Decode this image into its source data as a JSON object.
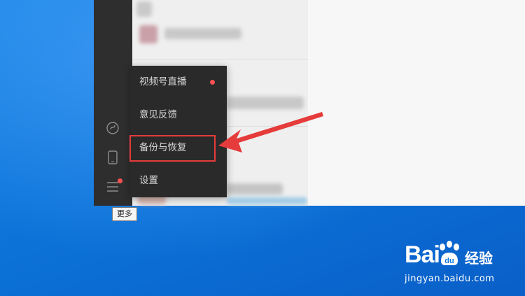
{
  "colors": {
    "desktop_blue": "#0f78dc",
    "sidebar_bg": "#2e2e2e",
    "menu_bg": "#2a2a2a",
    "notification_red": "#fa5151",
    "annotation_red": "#e63b3b"
  },
  "sidebar": {
    "icons": [
      "mini-program-icon",
      "phone-icon",
      "more-menu-icon"
    ]
  },
  "more_menu": {
    "items": [
      {
        "label": "视频号直播",
        "has_dot": true
      },
      {
        "label": "意见反馈",
        "has_dot": false
      },
      {
        "label": "备份与恢复",
        "has_dot": false
      },
      {
        "label": "设置",
        "has_dot": false
      }
    ],
    "highlighted_item": "备份与恢复"
  },
  "tooltip": {
    "text": "更多"
  },
  "watermark": {
    "brand": "Bai",
    "brand_suffix": "经验",
    "url": "jingyan.baidu.com"
  }
}
